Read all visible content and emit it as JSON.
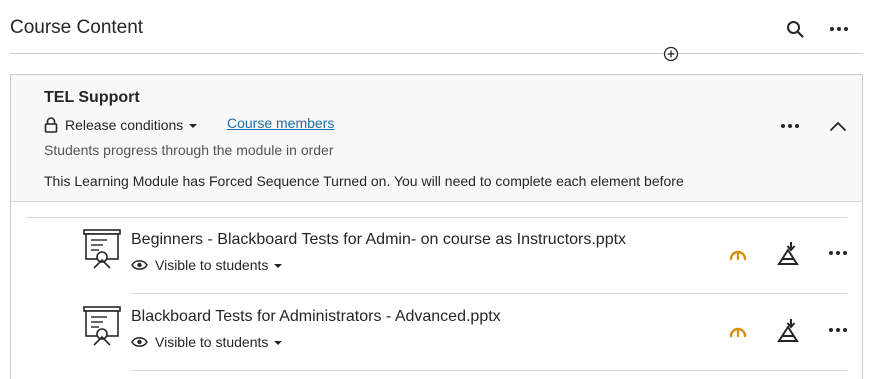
{
  "header": {
    "title": "Course Content",
    "search_icon": "search-icon",
    "more_icon": "more-options-icon"
  },
  "add_icon": "add-content-icon",
  "module": {
    "title": "TEL Support",
    "release_conditions": "Release conditions",
    "course_members": "Course members",
    "progress_note": "Students progress through the module in order",
    "description": "This Learning Module has Forced Sequence Turned on. You will need to complete each element before"
  },
  "items": [
    {
      "title": "Beginners - Blackboard Tests for Admin- on course as Instructors.pptx",
      "visibility": "Visible to students",
      "icon": "presentation-file-icon"
    },
    {
      "title": "Blackboard Tests for Administrators - Advanced.pptx",
      "visibility": "Visible to students",
      "icon": "presentation-file-icon"
    }
  ],
  "colors": {
    "link": "#1d6ea8",
    "gauge": "#d98c0b",
    "text": "#262626",
    "module_bg": "#f8f8f8"
  }
}
